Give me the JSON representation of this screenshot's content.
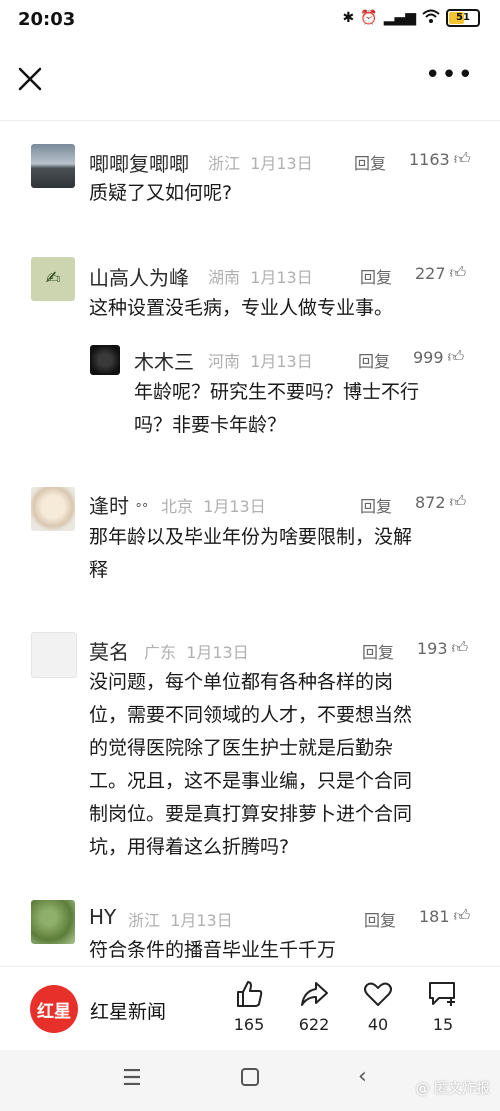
{
  "status_bar": {
    "time": "20:03",
    "battery": "51"
  },
  "header": {
    "more_label": "•••"
  },
  "comments": [
    {
      "name": "唧唧复唧唧",
      "location": "浙江",
      "date": "1月13日",
      "reply": "回复",
      "likes": "1163",
      "content": "质疑了又如何呢?"
    },
    {
      "name": "山高人为峰",
      "location": "湖南",
      "date": "1月13日",
      "reply": "回复",
      "likes": "227",
      "content": "这种设置没毛病，专业人做专业事。"
    },
    {
      "name": "木木三",
      "location": "河南",
      "date": "1月13日",
      "reply": "回复",
      "likes": "999",
      "content_line1": "年龄呢？研究生不要吗？博士不行",
      "content_line2": "吗？非要卡年龄？"
    },
    {
      "name": "逢时",
      "name_suffix": "°°",
      "location": "北京",
      "date": "1月13日",
      "reply": "回复",
      "likes": "872",
      "content_line1": "那年龄以及毕业年份为啥要限制，没解",
      "content_line2": "释"
    },
    {
      "name": "莫名",
      "location": "广东",
      "date": "1月13日",
      "reply": "回复",
      "likes": "193",
      "content_line1": "没问题，每个单位都有各种各样的岗",
      "content_line2": "位，需要不同领域的人才，不要想当然",
      "content_line3": "的觉得医院除了医生护士就是后勤杂",
      "content_line4": "工。况且，这不是事业编，只是个合同",
      "content_line5": "制岗位。要是真打算安排萝卜进个合同",
      "content_line6": "坑，用得着这么折腾吗?"
    },
    {
      "name": "HY",
      "location": "浙江",
      "date": "1月13日",
      "reply": "回复",
      "likes": "181",
      "content": "符合条件的播音毕业生千千万"
    }
  ],
  "bottom_bar": {
    "brand_logo_text": "红星",
    "brand_name": "红星新闻",
    "like_count": "165",
    "share_count": "622",
    "favorite_count": "40",
    "comment_count": "15"
  },
  "watermark": "@ 匿文炸报",
  "colors": {
    "brand": "#e8302b",
    "battery": "#f4c430"
  }
}
